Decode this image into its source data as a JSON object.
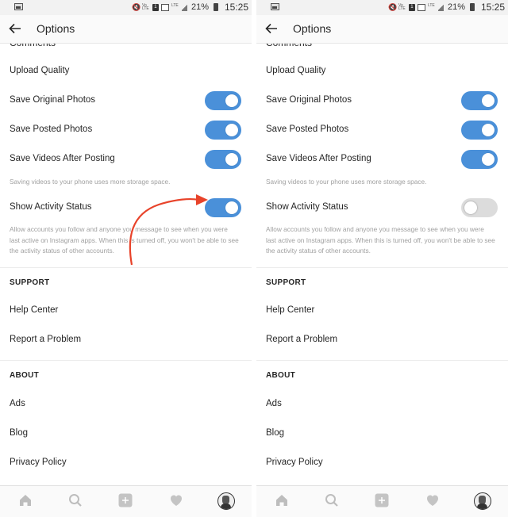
{
  "status_bar": {
    "battery": "21%",
    "time": "15:25",
    "icons": [
      "gallery-icon",
      "mute-icon",
      "volte-icon",
      "sim-icon",
      "signal-icon",
      "lte-icon",
      "signal-bars-icon",
      "battery-icon"
    ]
  },
  "screens": [
    {
      "app_bar": {
        "title": "Options",
        "back_icon": "arrow-left-icon"
      },
      "clipped_item": "Comments",
      "settings": [
        {
          "label": "Upload Quality"
        },
        {
          "label": "Save Original Photos",
          "toggle": true
        },
        {
          "label": "Save Posted Photos",
          "toggle": true
        },
        {
          "label": "Save Videos After Posting",
          "toggle": true
        }
      ],
      "videos_hint": "Saving videos to your phone uses more storage space.",
      "activity": {
        "label": "Show Activity Status",
        "toggle": true,
        "hint_lines": [
          "Allow accounts you follow and anyone you message to see when you were",
          "last active on Instagram apps. When this is turned off, you won't be able to see",
          "the activity status of other accounts."
        ]
      },
      "support": {
        "header": "SUPPORT",
        "items": [
          "Help Center",
          "Report a Problem"
        ]
      },
      "about": {
        "header": "ABOUT",
        "items": [
          "Ads",
          "Blog",
          "Privacy Policy"
        ]
      },
      "annotation": {
        "type": "curved-arrow",
        "color": "#e8432a",
        "points_to": "Show Activity Status toggle"
      }
    },
    {
      "app_bar": {
        "title": "Options",
        "back_icon": "arrow-left-icon"
      },
      "clipped_item": "Comments",
      "settings": [
        {
          "label": "Upload Quality"
        },
        {
          "label": "Save Original Photos",
          "toggle": true
        },
        {
          "label": "Save Posted Photos",
          "toggle": true
        },
        {
          "label": "Save Videos After Posting",
          "toggle": true
        }
      ],
      "videos_hint": "Saving videos to your phone uses more storage space.",
      "activity": {
        "label": "Show Activity Status",
        "toggle": false,
        "hint_lines": [
          "Allow accounts you follow and anyone you message to see when you were",
          "last active on Instagram apps. When this is turned off, you won't be able to see",
          "the activity status of other accounts."
        ]
      },
      "support": {
        "header": "SUPPORT",
        "items": [
          "Help Center",
          "Report a Problem"
        ]
      },
      "about": {
        "header": "ABOUT",
        "items": [
          "Ads",
          "Blog",
          "Privacy Policy"
        ]
      }
    }
  ],
  "tab_bar": {
    "tabs": [
      "home-icon",
      "search-icon",
      "add-post-icon",
      "heart-icon",
      "profile-avatar"
    ]
  },
  "colors": {
    "toggle_on": "#4a90d9",
    "toggle_off": "#dcdcdc",
    "arrow": "#e8432a",
    "hint_text": "#a0a0a0"
  }
}
